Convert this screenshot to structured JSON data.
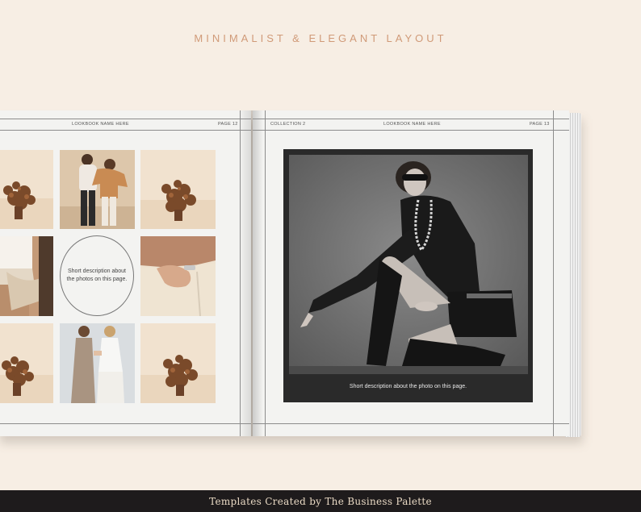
{
  "headline": "MINIMALIST & ELEGANT LAYOUT",
  "left_page": {
    "header_center": "LOOKBOOK NAME HERE",
    "header_right": "PAGE 12",
    "circle_text": "Short description about the photos on this page."
  },
  "right_page": {
    "header_left": "COLLECTION 2",
    "header_center": "LOOKBOOK NAME HERE",
    "header_right": "PAGE 13",
    "photo_caption": "Short description about the photo on this page."
  },
  "footer": "Templates Created by The Business Palette",
  "colors": {
    "background": "#f7eee4",
    "headline": "#d09a78",
    "footer_bar": "#1e1b1c",
    "footer_text": "#e9d9c4"
  }
}
